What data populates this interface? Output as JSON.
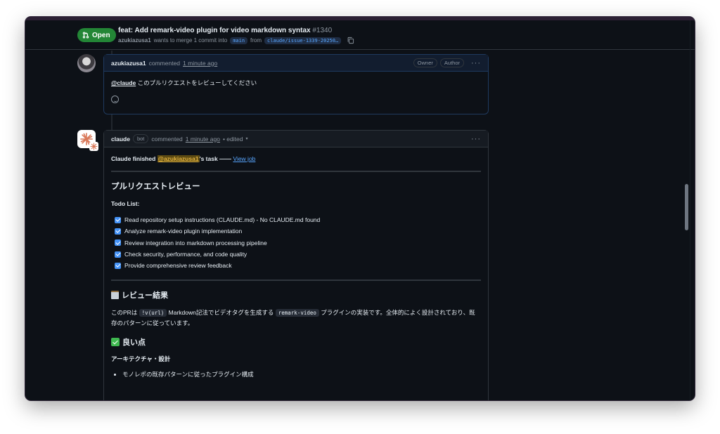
{
  "header": {
    "state": "Open",
    "title": "feat: Add remark-video plugin for video markdown syntax",
    "number": "#1340",
    "author": "azukiazusa1",
    "meta_text": "wants to merge 1 commit into",
    "base_branch": "main",
    "from_text": "from",
    "head_branch": "claude/issue-1339-20250…"
  },
  "comment1": {
    "author": "azukiazusa1",
    "action": "commented",
    "time": "1 minute ago",
    "labels": [
      "Owner",
      "Author"
    ],
    "mention": "@claude",
    "body": " このプルリクエストをレビューしてください"
  },
  "comment2": {
    "author": "claude",
    "bot_label": "bot",
    "action": "commented",
    "time": "1 minute ago",
    "edited": "• edited",
    "status_prefix": "Claude finished ",
    "status_mention": "@azukiazusa1",
    "status_suffix": "'s task —— ",
    "view_job": "View job",
    "review_title": "プルリクエストレビュー",
    "todo_title": "Todo List:",
    "todos": [
      "Read repository setup instructions (CLAUDE.md) - No CLAUDE.md found",
      "Analyze remark-video plugin implementation",
      "Review integration into markdown processing pipeline",
      "Check security, performance, and code quality",
      "Provide comprehensive review feedback"
    ],
    "result_title": "レビュー結果",
    "para_1": "このPRは ",
    "code_1": "!v(url)",
    "para_2": " Markdown記法でビデオタグを生成する ",
    "code_2": "remark-video",
    "para_3": " プラグインの実装です。全体的によく設計されており、既存のパターンに従っています。",
    "good_title": "良い点",
    "arch_title": "アーキテクチャ・設計",
    "bullet_1": "モノレポの既存パターンに従ったプラグイン構成"
  },
  "colors": {
    "open_green": "#238636",
    "link_blue": "#58a6ff",
    "checkbox_blue": "#4493f8",
    "mention_highlight": "#e3b341"
  }
}
